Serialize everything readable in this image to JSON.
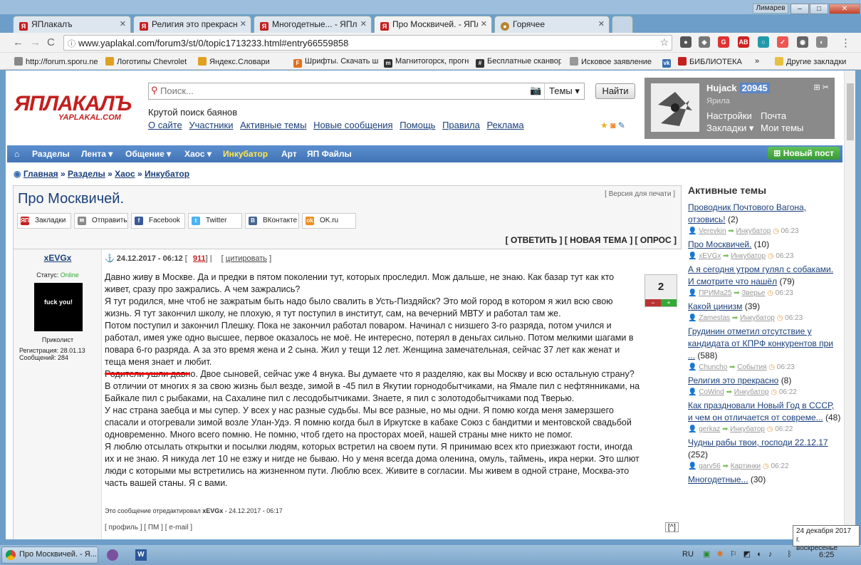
{
  "window": {
    "user": "Лимарев",
    "min": "–",
    "max": "□",
    "close": "✕"
  },
  "tabs": [
    {
      "label": "ЯПлакалъ",
      "active": false,
      "fav": "Я",
      "color": "#c41f1f"
    },
    {
      "label": "Религия это прекрасно",
      "active": false,
      "fav": "Я",
      "color": "#c41f1f"
    },
    {
      "label": "Многодетные... - ЯПлакал",
      "active": false,
      "fav": "Я",
      "color": "#c41f1f"
    },
    {
      "label": "Про Москвичей. - ЯПлакал",
      "active": true,
      "fav": "Я",
      "color": "#c41f1f"
    },
    {
      "label": "Горячее",
      "active": false,
      "fav": "●",
      "color": "#b8842e"
    }
  ],
  "nav": {
    "back": "←",
    "forward": "→",
    "reload": "C",
    "url": "www.yaplakal.com/forum3/st/0/topic1713233.html#entry66559858",
    "menu": "⋮"
  },
  "bookmarks": [
    {
      "label": "http://forum.sporu.ne",
      "color": "#888"
    },
    {
      "label": "Логотипы Chevrolet",
      "color": "#e0a020"
    },
    {
      "label": "Яндекс.Словари",
      "color": "#e0a020"
    },
    {
      "label": "Шрифты. Скачать шр",
      "color": "#e07020"
    },
    {
      "label": "Магнитогорск, прогн",
      "color": "#333"
    },
    {
      "label": "Бесплатные сканвор",
      "color": "#333"
    },
    {
      "label": "Исковое заявление",
      "color": "#999"
    },
    {
      "label": "",
      "color": "#3a6fb0"
    },
    {
      "label": "БИБЛИОТЕКА",
      "color": "#c41f1f"
    },
    {
      "label": "»",
      "color": ""
    },
    {
      "label": "Другие закладки",
      "color": "#e8c040"
    }
  ],
  "site": {
    "logo": "ЯПЛАКАЛЪ",
    "logo_sub": "YAPLAKAL.COM",
    "search_placeholder": "Поиск...",
    "search_scope": "Темы ▾",
    "search_button": "Найти",
    "tagline": "Крутой поиск баянов",
    "links": [
      "О сайте",
      "Участники",
      "Активные темы",
      "Новые сообщения",
      "Помощь",
      "Правила",
      "Реклама"
    ]
  },
  "user": {
    "nick": "Hujack",
    "rep": "20945",
    "rank": "Ярила",
    "settings": "Настройки",
    "mail": "Почта",
    "bookmarks": "Закладки ▾",
    "my_topics": "Мои темы"
  },
  "menu": {
    "home": "⌂",
    "items": [
      "Разделы",
      "Лента ▾",
      "Общение ▾",
      "Хаос ▾",
      "Инкубатор",
      "Арт",
      "ЯП Файлы"
    ],
    "new_post": "Новый пост"
  },
  "breadcrumb": [
    "Главная",
    "Разделы",
    "Хаос",
    "Инкубатор"
  ],
  "topic": {
    "title": "Про Москвичей.",
    "print": "[ Версия для печати ]",
    "share": [
      "Закладки",
      "Отправить",
      "Facebook",
      "Twitter",
      "ВКонтакте",
      "OK.ru"
    ],
    "actions": "[ ОТВЕТИТЬ ] [ НОВАЯ ТЕМА ] [ ОПРОС ]"
  },
  "post": {
    "author": "xEVGx",
    "status_label": "Статус:",
    "status": "Online",
    "avatar_text": "fuck you!",
    "rank": "Приколист",
    "registered": "Регистрация: 28.01.13",
    "messages": "Сообщений: 284",
    "date": "24.12.2017 - 06:12",
    "num": "911",
    "quote": "цитировать",
    "rating": "2",
    "minus": "−",
    "plus": "+",
    "text": [
      "Давно живу в Москве. Да и предки в пятом поколении тут, которых проследил. Мож дальше, не знаю. Как базар тут как кто живет, сразу про зажрались. А чем зажрались?",
      "Я тут родился, мне чтоб не зажратым быть надо было свалить в Усть-Пиздяйск? Это мой город в котором я жил всю свою жизнь. Я тут закончил школу, не плохую, я тут поступил в институт, сам, на вечерний МВТУ и работал там же.",
      "Потом поступил и закончил Плешку. Пока не закончил работал поваром. Начинал с низшего 3-го разряда, потом учился и работал, имея уже одно высшее, первое оказалось не моё. Не интересно, потерял в деньгах сильно. Потом мелкими шагами в повара 6-го разряда. А за это время жена и 2 сына. Жил у тещи 12 лет. Женщина замечательная, сейчас 37 лет как женат и теща меня знает и любит.",
      "Родители ушли давно. Двое сыновей, сейчас уже 4 внука. Вы думаете что я разделяю, как вы Москву и всю остальную страну?",
      "В отличии от многих я за свою жизнь был везде, зимой в -45 пил в Якутии горнодобытчиками, на Ямале пил с нефтянниками, на Байкале пил с рыбаками, на Сахалине пил с лесодобытчиками. Знаете, я пил с золотодобытчиками под Тверью.",
      "У нас страна заебца и мы супер. У всех у нас разные судьбы. Мы все разные, но мы одни. Я помю когда меня замерзшего спасали и отогревали зимой возле Улан-Удэ. Я помню когда был в Иркутске в кабаке Союз с бандитми и ментовской свадьбой одновременно. Много всего помню. Не помню, чтоб гдето на просторах моей, нашей страны мне никто не помог.",
      "Я люблю отсылать открытки и посылки людям, которых встретил на своем пути. Я принимаю всех кто приезжают гости, иногда их и не знаю. Я никуда лет 10 не езжу и нигде не бываю. Но у меня всегда дома оленина, омуль, таймень, икра нерки. Это шлют люди с которыми мы встретились на жизненном пути. Люблю всех. Живите в согласии. Мы живем в одной стране, Москва-это часть вашей станы. Я с вами."
    ],
    "edited_prefix": "Это сообщение отредактировал ",
    "edited_user": "xEVGx",
    "edited_suffix": " - 24.12.2017 - 06:17",
    "links": "[ профиль ] [ ПМ ] [ e-mail ]",
    "up": "[^]"
  },
  "sidebar": {
    "title": "Активные темы",
    "items": [
      {
        "title": "Проводник Почтового Вагона, отзовись!",
        "count": "(2)",
        "user": "Verevkin",
        "section": "Инкубатор",
        "time": "06:23"
      },
      {
        "title": "Про Москвичей.",
        "count": "(10)",
        "user": "xEVGx",
        "section": "Инкубатор",
        "time": "06:23"
      },
      {
        "title": "А я сегодня утром гулял с собаками. И смотрите что нашёл",
        "count": "(79)",
        "user": "ПРИМа25",
        "section": "Зверье",
        "time": "06:23"
      },
      {
        "title": "Какой цинизм",
        "count": "(39)",
        "user": "Zamestas",
        "section": "Инкубатор",
        "time": "06:23"
      },
      {
        "title": "Грудинин отметил отсутствие у кандидата от КПРФ конкурентов при ...",
        "count": "(588)",
        "user": "Chuncho",
        "section": "События",
        "time": "06:23"
      },
      {
        "title": "Религия это прекрасно",
        "count": "(8)",
        "user": "CoWind",
        "section": "Инкубатор",
        "time": "06:22"
      },
      {
        "title": "Как праздновали Новый Год в СССР, и чем он отличается от совреме...",
        "count": "(48)",
        "user": "gerkaz",
        "section": "Инкубатор",
        "time": "06:22"
      },
      {
        "title": "Чудны рабы твои, господи 22.12.17",
        "count": "(252)",
        "user": "garv56",
        "section": "Картинки",
        "time": "06:22"
      },
      {
        "title": "Многодетные...",
        "count": "(30)",
        "user": "",
        "section": "",
        "time": ""
      }
    ]
  },
  "taskbar": {
    "task": "Про Москвичей. - Я...",
    "lang": "RU",
    "time": "6:25"
  },
  "tooltip": {
    "line1": "24 декабря 2017 г.",
    "line2": "воскресенье"
  }
}
